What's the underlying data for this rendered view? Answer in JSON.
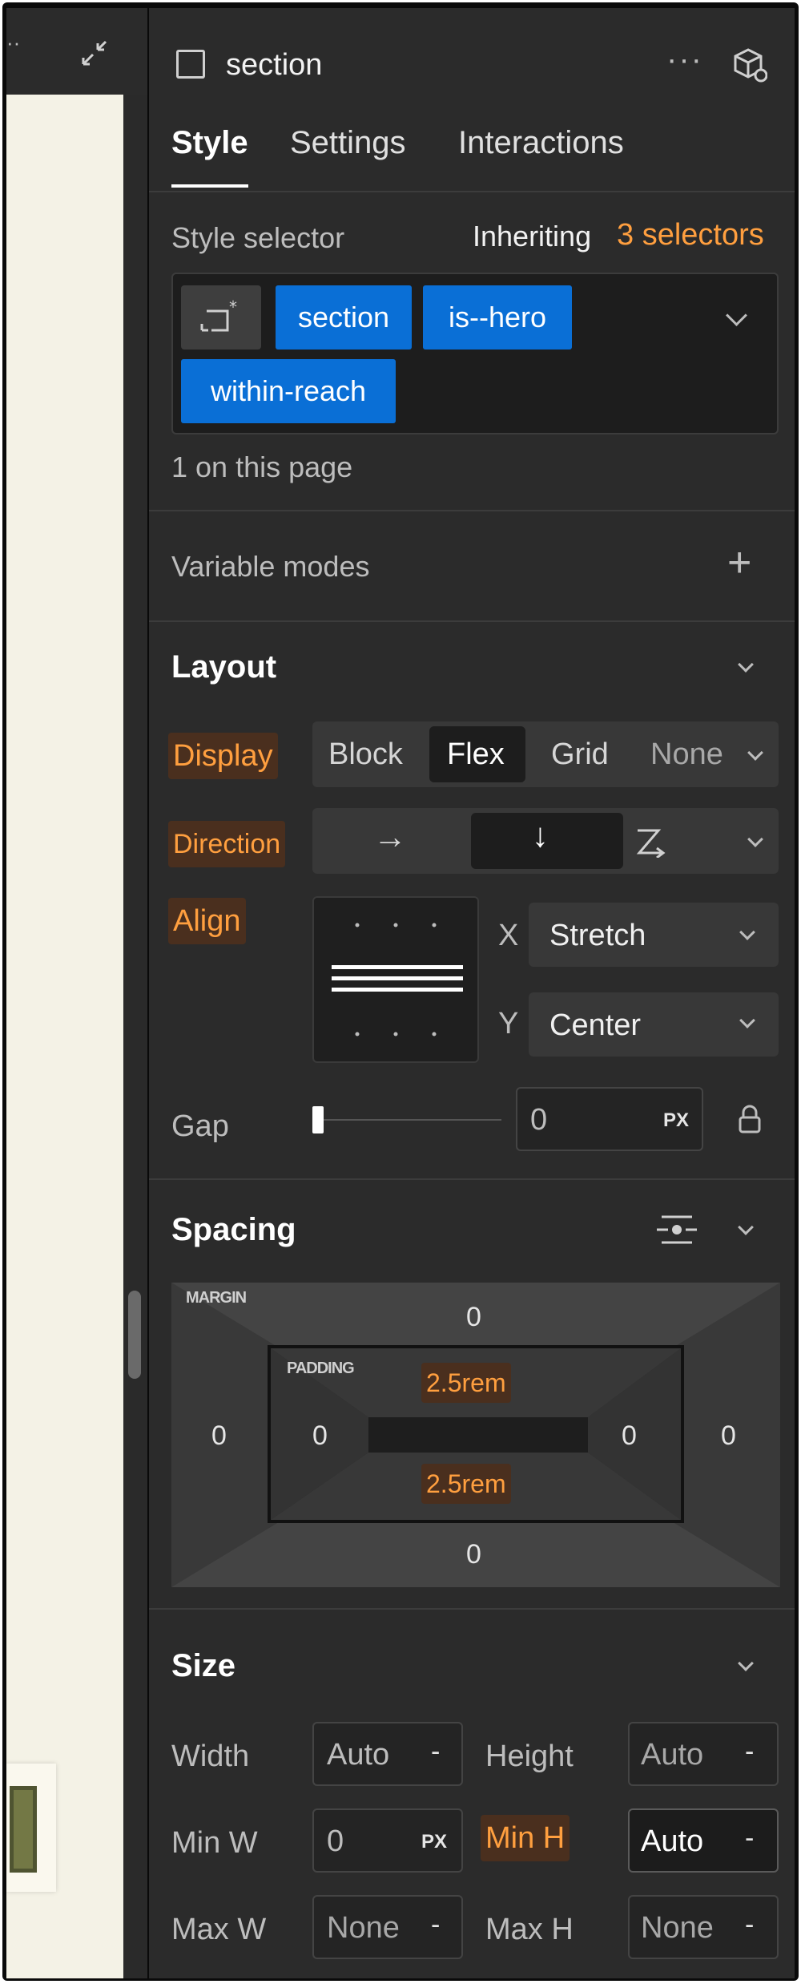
{
  "element": {
    "icon": "element-box-icon",
    "name": "section"
  },
  "tabs": [
    "Style",
    "Settings",
    "Interactions"
  ],
  "style_selector": {
    "label": "Style selector",
    "inheriting_prefix": "Inheriting",
    "inheriting_count": "3 selectors",
    "chips": [
      "section",
      "is--hero",
      "within-reach"
    ],
    "on_page": "1 on this page"
  },
  "variable_modes": {
    "label": "Variable modes",
    "add": "+"
  },
  "layout": {
    "title": "Layout",
    "display_label": "Display",
    "display_options": [
      "Block",
      "Flex",
      "Grid",
      "None"
    ],
    "display_selected": "Flex",
    "direction_label": "Direction",
    "direction_arrows": [
      "→",
      "↓"
    ],
    "align_label": "Align",
    "x_label": "X",
    "x_value": "Stretch",
    "y_label": "Y",
    "y_value": "Center",
    "gap_label": "Gap",
    "gap_value": "0",
    "gap_unit": "PX"
  },
  "spacing": {
    "title": "Spacing",
    "margin_label": "MARGIN",
    "padding_label": "PADDING",
    "margin": {
      "top": "0",
      "right": "0",
      "bottom": "0",
      "left": "0"
    },
    "padding": {
      "top": "2.5rem",
      "right": "0",
      "bottom": "2.5rem",
      "left": "0"
    }
  },
  "size": {
    "title": "Size",
    "width_label": "Width",
    "width_value": "Auto",
    "height_label": "Height",
    "height_value": "Auto",
    "min_w_label": "Min W",
    "min_w_value": "0",
    "min_w_unit": "PX",
    "min_h_label": "Min H",
    "min_h_value": "Auto",
    "max_w_label": "Max W",
    "max_w_value": "None",
    "max_h_label": "Max H",
    "max_h_value": "None",
    "dash": "-"
  },
  "colors": {
    "accent": "#ff9f3f",
    "chip": "#0a6fd6",
    "panel": "#2b2b2b",
    "canvas": "#f4f2e6"
  }
}
